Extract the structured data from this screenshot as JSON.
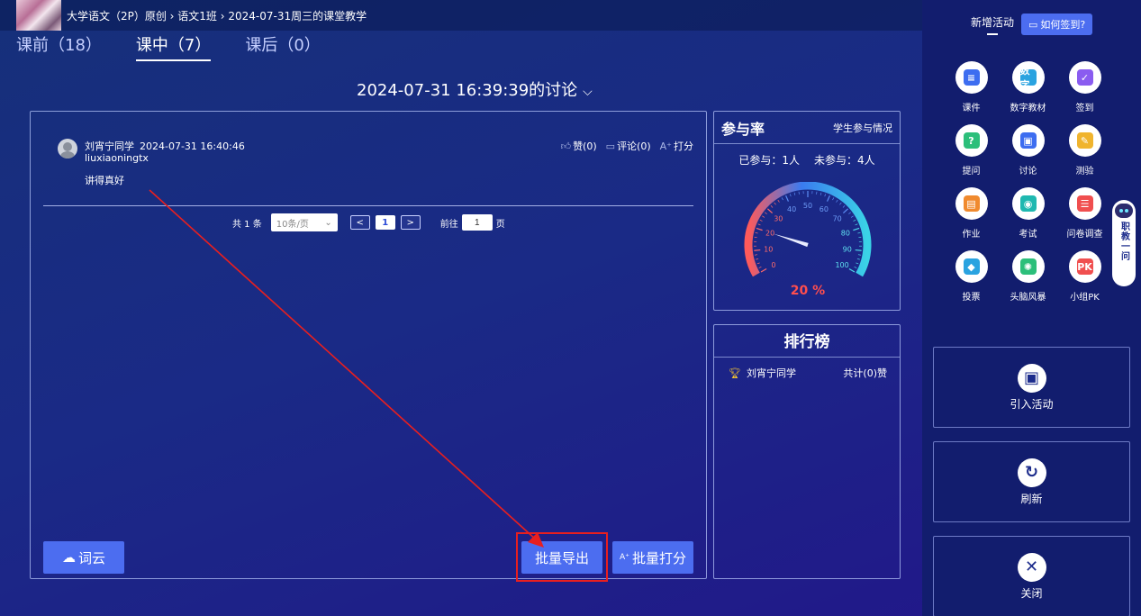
{
  "breadcrumb": "大学语文（2P）原创 › 语文1班 › 2024-07-31周三的课堂教学",
  "tabs": [
    {
      "label": "课前（18）"
    },
    {
      "label": "课中（7）"
    },
    {
      "label": "课后（0）"
    }
  ],
  "discussion_title": "2024-07-31 16:39:39的讨论",
  "post": {
    "author": "刘宵宁同学",
    "time": "2024-07-31 16:40:46",
    "username": "liuxiaoningtx",
    "content": "讲得真好",
    "like": "赞(0)",
    "comment": "评论(0)",
    "grade": "打分"
  },
  "pager": {
    "total": "共 1 条",
    "page_size": "10条/页",
    "prev": "<",
    "current": "1",
    "next": ">",
    "goto_label": "前往",
    "goto_value": "1",
    "page_unit": "页"
  },
  "buttons": {
    "word_cloud": "词云",
    "batch_export": "批量导出",
    "batch_grade": "批量打分"
  },
  "participation": {
    "title": "参与率",
    "link": "学生参与情况",
    "joined": "已参与：1人",
    "not_joined": "未参与：4人",
    "value_text": "20 %",
    "percent": 20,
    "ticks": [
      "0",
      "10",
      "20",
      "30",
      "40",
      "50",
      "60",
      "70",
      "80",
      "90",
      "100"
    ]
  },
  "ranking": {
    "title": "排行榜",
    "rows": [
      {
        "name": "刘宵宁同学",
        "score": "共计(0)赞"
      }
    ]
  },
  "sidebar": {
    "new_activity": "新增活动",
    "how_checkin": "如何签到?",
    "tools": [
      {
        "label": "课件",
        "icon": "courseware-icon",
        "color": "#3d6df0",
        "glyph": "≡"
      },
      {
        "label": "数字教材",
        "icon": "digital-textbook-icon",
        "color": "#2aa3e0",
        "glyph": "数字"
      },
      {
        "label": "签到",
        "icon": "checkin-icon",
        "color": "#8a5cf0",
        "glyph": "✓"
      },
      {
        "label": "提问",
        "icon": "question-icon",
        "color": "#2cbf7a",
        "glyph": "?"
      },
      {
        "label": "讨论",
        "icon": "discussion-icon",
        "color": "#3d6df0",
        "glyph": "▣"
      },
      {
        "label": "测验",
        "icon": "quiz-icon",
        "color": "#f0b42e",
        "glyph": "✎"
      },
      {
        "label": "作业",
        "icon": "homework-icon",
        "color": "#f08a2e",
        "glyph": "▤"
      },
      {
        "label": "考试",
        "icon": "exam-icon",
        "color": "#1fb8b0",
        "glyph": "◉"
      },
      {
        "label": "问卷调查",
        "icon": "survey-icon",
        "color": "#f04f4f",
        "glyph": "☰"
      },
      {
        "label": "投票",
        "icon": "vote-icon",
        "color": "#2aa3e0",
        "glyph": "◆"
      },
      {
        "label": "头脑风暴",
        "icon": "brainstorm-icon",
        "color": "#2cbf7a",
        "glyph": "✺"
      },
      {
        "label": "小组PK",
        "icon": "group-pk-icon",
        "color": "#f04f4f",
        "glyph": "PK"
      }
    ],
    "import_activity": "引入活动",
    "refresh": "刷新",
    "close": "关闭",
    "bot_label": "职教一问"
  },
  "colors": {
    "accent": "#4c6df0",
    "highlight": "#e81f1f",
    "gauge_low": "#ff5a5a",
    "gauge_high": "#3ad3e6"
  }
}
